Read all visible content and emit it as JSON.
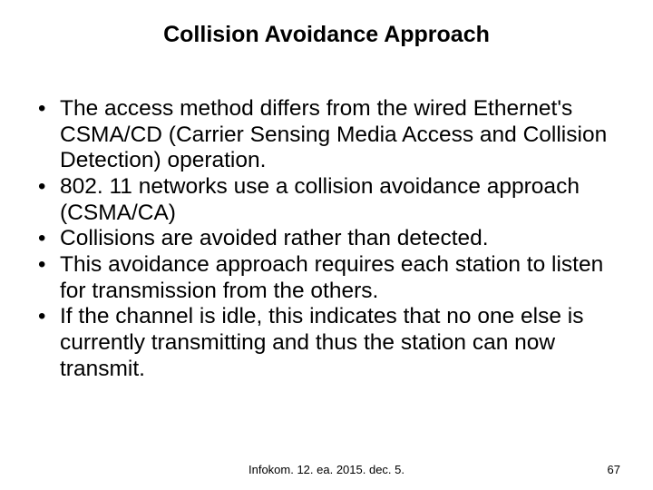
{
  "title": "Collision Avoidance Approach",
  "bullets": [
    "The access method differs from the wired Ethernet's CSMA/CD (Carrier Sensing Media Access and Collision Detection) operation.",
    "802. 11 networks use a collision avoidance approach (CSMA/CA)",
    "Collisions are avoided rather than detected.",
    "This avoidance approach requires each station to listen for transmission from the others.",
    "If the channel is idle, this indicates that no one else is currently transmitting and thus the station can now transmit."
  ],
  "footer": {
    "center": "Infokom. 12. ea. 2015. dec.  5.",
    "page": "67"
  }
}
